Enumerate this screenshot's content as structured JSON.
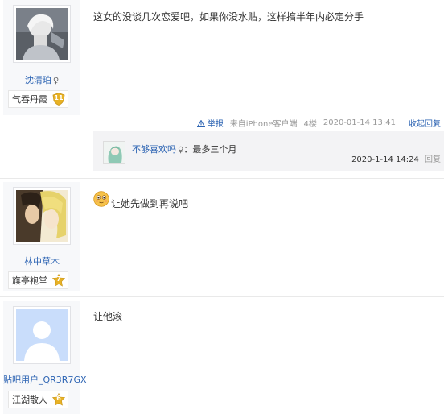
{
  "posts": [
    {
      "username": "沈清珀",
      "gender_mark": "♀",
      "level_title": "气吞丹霞",
      "level_num": "11",
      "content": "这女的没谈几次恋爱吧，如果你没水贴，这样搞半年内必定分手",
      "meta": {
        "report": "举报",
        "source": "来自iPhone客户端",
        "floor": "4楼",
        "time": "2020-01-14 13:41",
        "collapse": "收起回复"
      },
      "reply": {
        "user": "不够喜欢吗",
        "gender_mark": "♀",
        "separator": "：",
        "text": "最多三个月",
        "time": "2020-1-14 14:24",
        "action": "回复"
      }
    },
    {
      "username": "林中草木",
      "level_title": "旗亭袍堂",
      "level_num": "7",
      "content": "让她先做到再说吧"
    },
    {
      "username": "贴吧用户_QR3R7GX",
      "level_title": "江湖散人",
      "level_num": "6",
      "content": "让他滚"
    }
  ]
}
